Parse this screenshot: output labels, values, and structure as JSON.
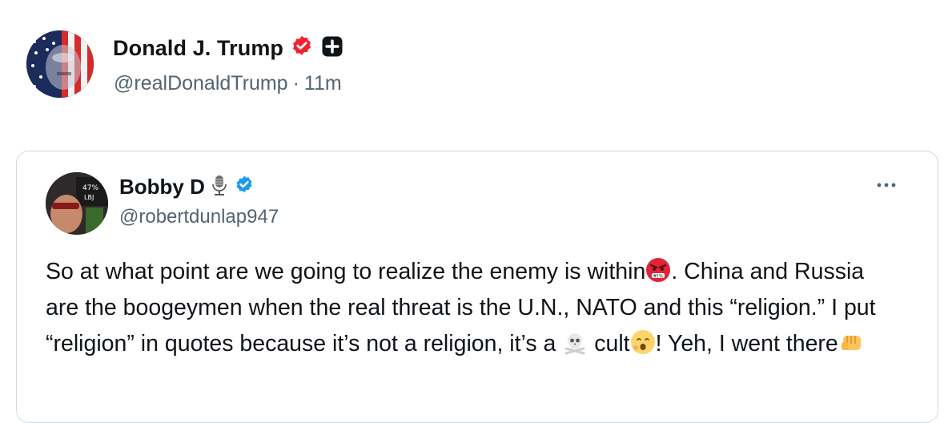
{
  "outer_post": {
    "author_name": "Donald J. Trump",
    "handle": "@realDonaldTrump",
    "separator": "·",
    "time": "11m",
    "verified_badge": "verified-badge-icon",
    "affiliate_badge": "affiliate-plus-icon"
  },
  "quoted_post": {
    "author_name": "Bobby D",
    "handle": "@robertdunlap947",
    "microphone_icon": "microphone-icon",
    "verified_badge": "verified-badge-icon",
    "more_icon": "more-options-icon",
    "text_parts": {
      "p1": "So at what point are we going to realize the enemy is within",
      "p2": ". China and Russia are the boogeymen when the real threat is the U.N., NATO and this “religion.” I put “religion” in quotes because it’s not a religion, it’s a ",
      "p3": " cult",
      "p4": "! Yeh, I went there"
    },
    "emojis": [
      "angry-face-icon",
      "skull-crossbones-icon",
      "yawning-face-icon",
      "fist-bump-icon"
    ]
  },
  "colors": {
    "text_primary": "#0f1419",
    "text_secondary": "#536471",
    "verified_blue": "#1d9bf0",
    "verified_red": "#f4212e",
    "card_border": "#cfd9de"
  }
}
